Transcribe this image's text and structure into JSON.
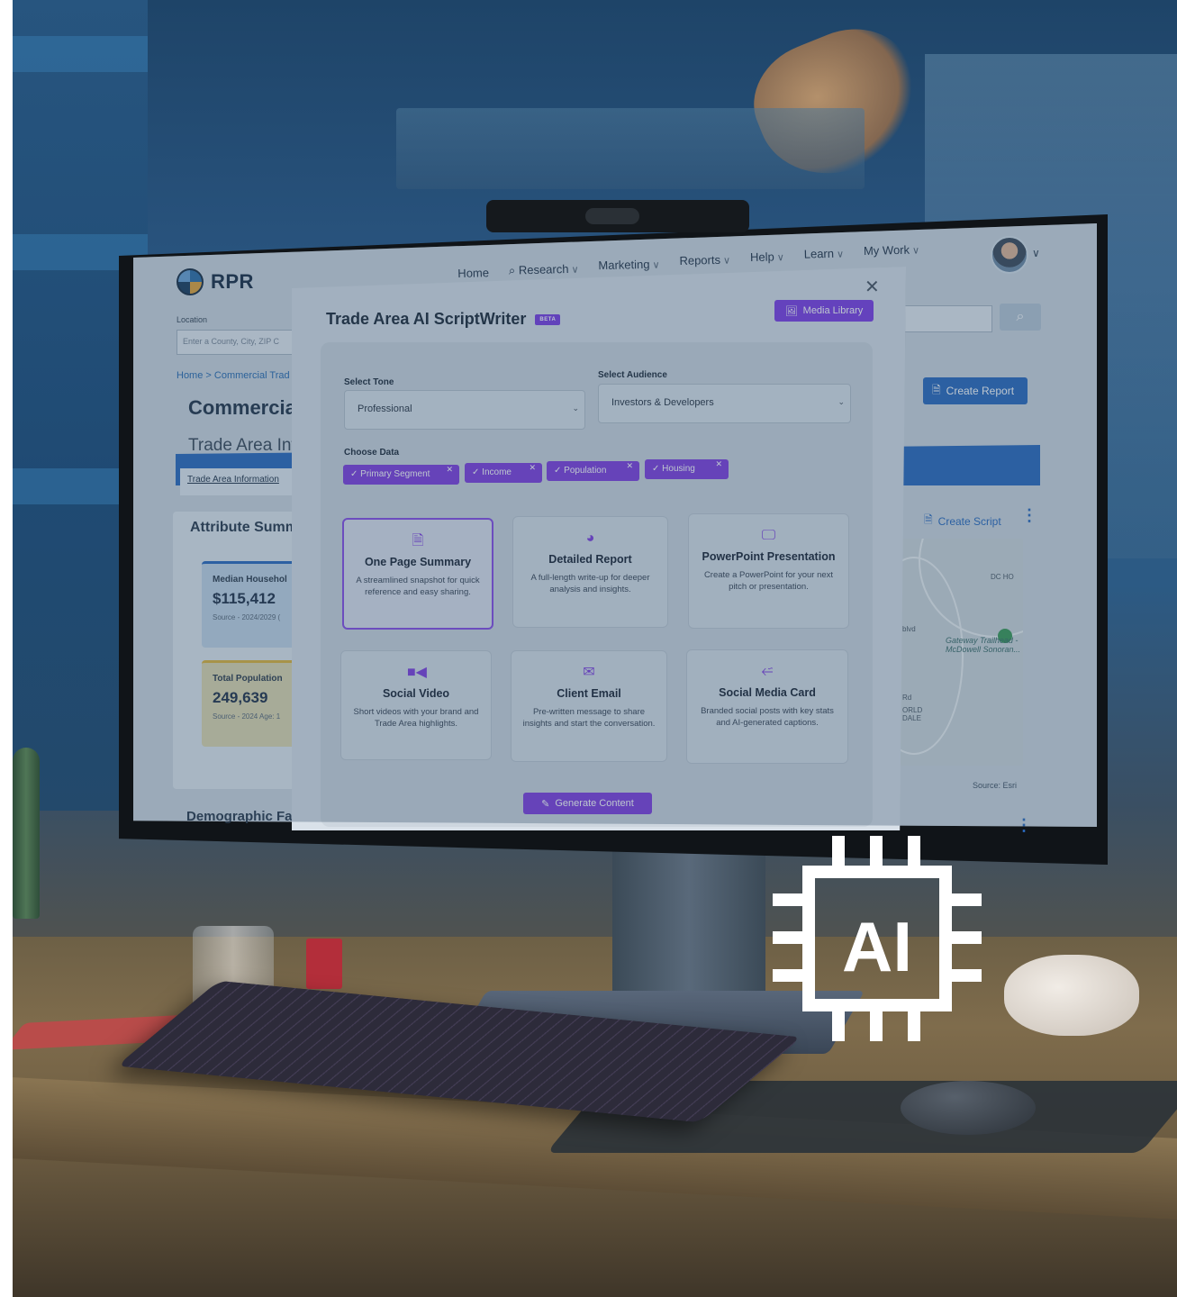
{
  "app": {
    "logo_text": "RPR",
    "nav": [
      {
        "label": "Home",
        "has_dropdown": false
      },
      {
        "label": "Research",
        "has_dropdown": true,
        "icon": "search-icon"
      },
      {
        "label": "Marketing",
        "has_dropdown": true
      },
      {
        "label": "Reports",
        "has_dropdown": true
      },
      {
        "label": "Help",
        "has_dropdown": true
      },
      {
        "label": "Learn",
        "has_dropdown": true
      },
      {
        "label": "My Work",
        "has_dropdown": true
      }
    ],
    "location_label": "Location",
    "location_placeholder": "Enter a County, City, ZIP C",
    "breadcrumb": "Home  >  Commercial Trad",
    "page_title": "Commercial",
    "page_subtitle": "Trade Area Infc",
    "create_report_label": "Create Report",
    "active_tab": "Trade Area Information",
    "attribute_title": "Attribute Summ",
    "stats": [
      {
        "label": "Median Househol",
        "value": "$115,412",
        "source": "Source - 2024/2029 ("
      },
      {
        "label": "Total Population",
        "value": "249,639",
        "source": "Source - 2024 Age: 1"
      }
    ],
    "demographic_title": "Demographic Fa",
    "create_script_label": "Create Script",
    "map_labels": {
      "gateway": "Gateway Trailhead - McDowell Sonoran...",
      "dc": "DC HO",
      "rd": "Rd",
      "world": "ORLD DALE",
      "blvd": "blvd"
    },
    "map_source": "Source: Esri"
  },
  "modal": {
    "title": "Trade Area AI ScriptWriter",
    "badge": "BETA",
    "media_library_label": "Media Library",
    "close_glyph": "✕",
    "tone_label": "Select Tone",
    "tone_value": "Professional",
    "audience_label": "Select Audience",
    "audience_value": "Investors & Developers",
    "choose_data_label": "Choose Data",
    "chips": [
      "Primary Segment",
      "Income",
      "Population",
      "Housing"
    ],
    "options": [
      {
        "title": "One Page Summary",
        "desc": "A streamlined snapshot for quick reference and easy sharing.",
        "icon": "document-icon",
        "selected": true
      },
      {
        "title": "Detailed Report",
        "desc": "A full-length write-up for deeper analysis and insights.",
        "icon": "pie-chart-icon",
        "selected": false
      },
      {
        "title": "PowerPoint Presentation",
        "desc": "Create a PowerPoint for your next pitch or presentation.",
        "icon": "presentation-icon",
        "selected": false
      },
      {
        "title": "Social Video",
        "desc": "Short videos with your brand and Trade Area highlights.",
        "icon": "video-icon",
        "selected": false
      },
      {
        "title": "Client Email",
        "desc": "Pre-written message to share insights and start the conversation.",
        "icon": "envelope-icon",
        "selected": false
      },
      {
        "title": "Social Media Card",
        "desc": "Branded social posts with key stats and AI-generated captions.",
        "icon": "share-icon",
        "selected": false
      }
    ],
    "generate_label": "Generate Content"
  },
  "overlay": {
    "ai_chip_text": "AI"
  },
  "colors": {
    "accent_purple": "#8040e0",
    "brand_blue": "#2b6bbf"
  }
}
